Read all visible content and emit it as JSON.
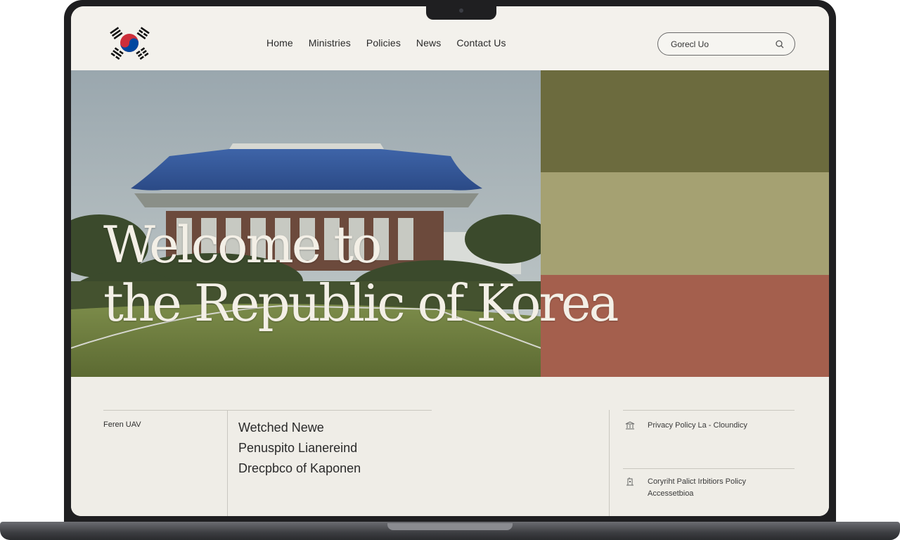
{
  "header": {
    "nav": [
      "Home",
      "Ministries",
      "Policies",
      "News",
      "Contact Us"
    ],
    "search": {
      "value": "Gorecl Uo"
    }
  },
  "hero": {
    "title_line1": "Welcome to",
    "title_line2": "the Republic of Korea",
    "swatch_colors": [
      "#6c6b3e",
      "#a5a172",
      "#a45f4d"
    ]
  },
  "content": {
    "side_label": "Feren UAV",
    "news": [
      "Wetched Newe",
      "Penuspito Lianereind",
      "Drecpbco of Kaponen"
    ],
    "footer_links": {
      "top": {
        "icon": "bank-icon",
        "text": "Privacy Policy  La - Cloundicy"
      },
      "bottom": {
        "icon": "building-icon",
        "line1": "Coryriht Palict Irbitiors Policy",
        "line2": "Accessetbioa"
      }
    }
  },
  "colors": {
    "screen_bg": "#efede7",
    "header_bg": "#f3f1ec",
    "frame": "#1f1f21"
  }
}
